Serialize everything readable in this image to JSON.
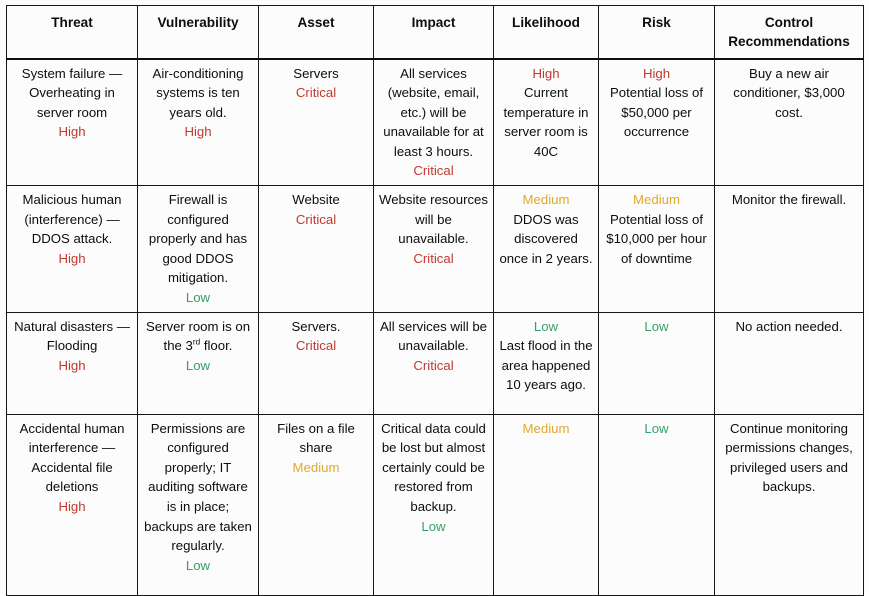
{
  "table": {
    "columns": [
      "Threat",
      "Vulnerability",
      "Asset",
      "Impact",
      "Likelihood",
      "Risk",
      "Control Recommendations"
    ],
    "rating_colors": {
      "high": "#c0392f",
      "critical": "#c0392f",
      "medium": "#e0a92e",
      "low": "#35a06a"
    },
    "rows": [
      {
        "threat": {
          "text": "System failure — Overheating in server room",
          "rating": "High",
          "rating_level": "high"
        },
        "vulnerability": {
          "text": "Air-conditioning systems is ten years old.",
          "rating": "High",
          "rating_level": "high"
        },
        "asset": {
          "text": "Servers",
          "rating": "Critical",
          "rating_level": "critical"
        },
        "impact": {
          "text": "All services (website, email, etc.) will be unavailable for at least 3 hours.",
          "rating": "Critical",
          "rating_level": "critical"
        },
        "likelihood": {
          "rating": "High",
          "rating_level": "high",
          "text": "Current temperature in server room is 40C"
        },
        "risk": {
          "rating": "High",
          "rating_level": "high",
          "text": "Potential loss of $50,000 per occurrence"
        },
        "control": {
          "text": "Buy a new air conditioner, $3,000 cost."
        }
      },
      {
        "threat": {
          "text": "Malicious human (interference) — DDOS attack.",
          "rating": "High",
          "rating_level": "high"
        },
        "vulnerability": {
          "text": "Firewall is configured properly and has good DDOS mitigation.",
          "rating": "Low",
          "rating_level": "low"
        },
        "asset": {
          "text": "Website",
          "rating": "Critical",
          "rating_level": "critical"
        },
        "impact": {
          "text": "Website resources will be unavailable.",
          "rating": "Critical",
          "rating_level": "critical"
        },
        "likelihood": {
          "rating": "Medium",
          "rating_level": "medium",
          "text": "DDOS was discovered once in 2 years."
        },
        "risk": {
          "rating": "Medium",
          "rating_level": "medium",
          "text": "Potential loss of $10,000 per hour of downtime"
        },
        "control": {
          "text": "Monitor the firewall."
        }
      },
      {
        "threat": {
          "text": "Natural disasters — Flooding",
          "rating": "High",
          "rating_level": "high"
        },
        "vulnerability": {
          "text_html": "Server room is on the 3<sup>rd</sup> floor.",
          "rating": "Low",
          "rating_level": "low"
        },
        "asset": {
          "text": "Servers.",
          "rating": "Critical",
          "rating_level": "critical"
        },
        "impact": {
          "text": "All services will be unavailable.",
          "rating": "Critical",
          "rating_level": "critical"
        },
        "likelihood": {
          "rating": "Low",
          "rating_level": "low",
          "text": "Last flood in the area happened 10 years ago."
        },
        "risk": {
          "rating": "Low",
          "rating_level": "low",
          "text": ""
        },
        "control": {
          "text": "No action needed."
        }
      },
      {
        "threat": {
          "text": "Accidental human interference — Accidental file deletions",
          "rating": "High",
          "rating_level": "high"
        },
        "vulnerability": {
          "text": "Permissions are configured properly; IT auditing software is in place; backups are taken regularly.",
          "rating": "Low",
          "rating_level": "low"
        },
        "asset": {
          "text": "Files on a file share",
          "rating": "Medium",
          "rating_level": "medium"
        },
        "impact": {
          "text": "Critical data could be lost but almost certainly could be restored from backup.",
          "rating": "Low",
          "rating_level": "low"
        },
        "likelihood": {
          "rating": "Medium",
          "rating_level": "medium",
          "text": ""
        },
        "risk": {
          "rating": "Low",
          "rating_level": "low",
          "text": ""
        },
        "control": {
          "text": "Continue monitoring permissions changes, privileged users and backups."
        }
      }
    ]
  }
}
